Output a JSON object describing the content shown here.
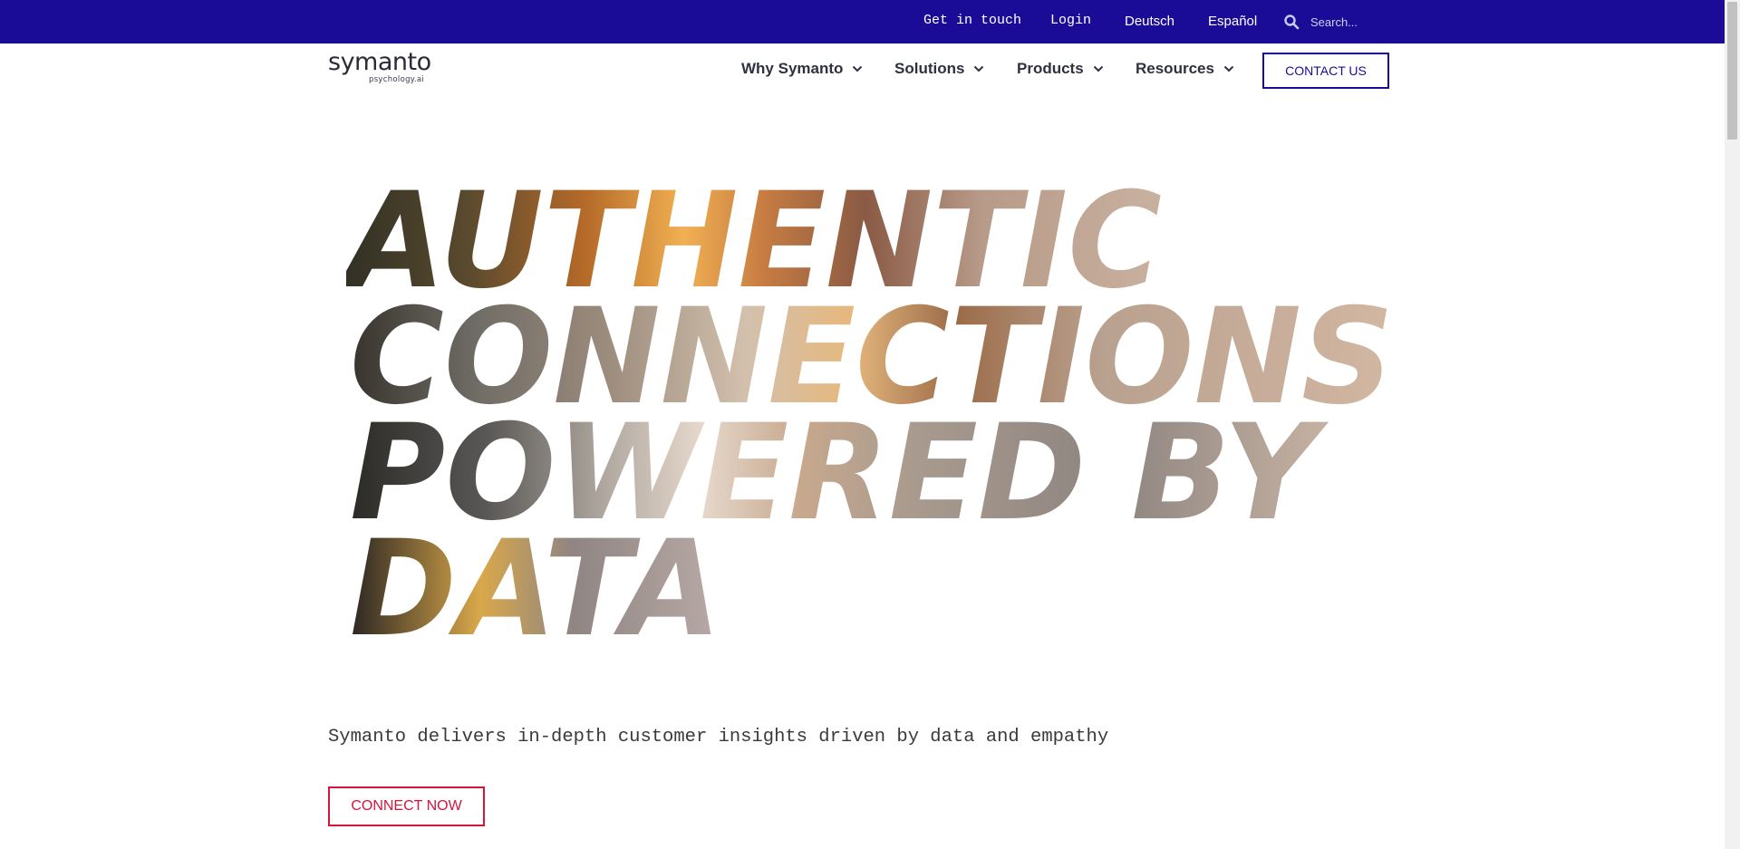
{
  "topbar": {
    "get_in_touch": "Get in touch",
    "login": "Login",
    "deutsch": "Deutsch",
    "espanol": "Español",
    "search_placeholder": "Search...",
    "search_icon": "search-icon"
  },
  "header": {
    "logo_word": "symanto",
    "logo_sub": "psychology.ai",
    "nav": [
      {
        "label": "Why Symanto",
        "icon": "chevron-down-icon"
      },
      {
        "label": "Solutions",
        "icon": "chevron-down-icon"
      },
      {
        "label": "Products",
        "icon": "chevron-down-icon"
      },
      {
        "label": "Resources",
        "icon": "chevron-down-icon"
      }
    ],
    "contact_label": "CONTACT US"
  },
  "hero": {
    "lines": [
      "AUTHENTIC",
      "CONNECTIONS",
      "POWERED BY",
      "DATA"
    ],
    "tagline": "Symanto delivers in-depth customer insights driven by data and empathy",
    "cta_label": "CONNECT NOW"
  },
  "colors": {
    "topbar_bg": "#1a0c96",
    "brand_blue": "#1a0c96",
    "cta_red": "#d3163b"
  }
}
